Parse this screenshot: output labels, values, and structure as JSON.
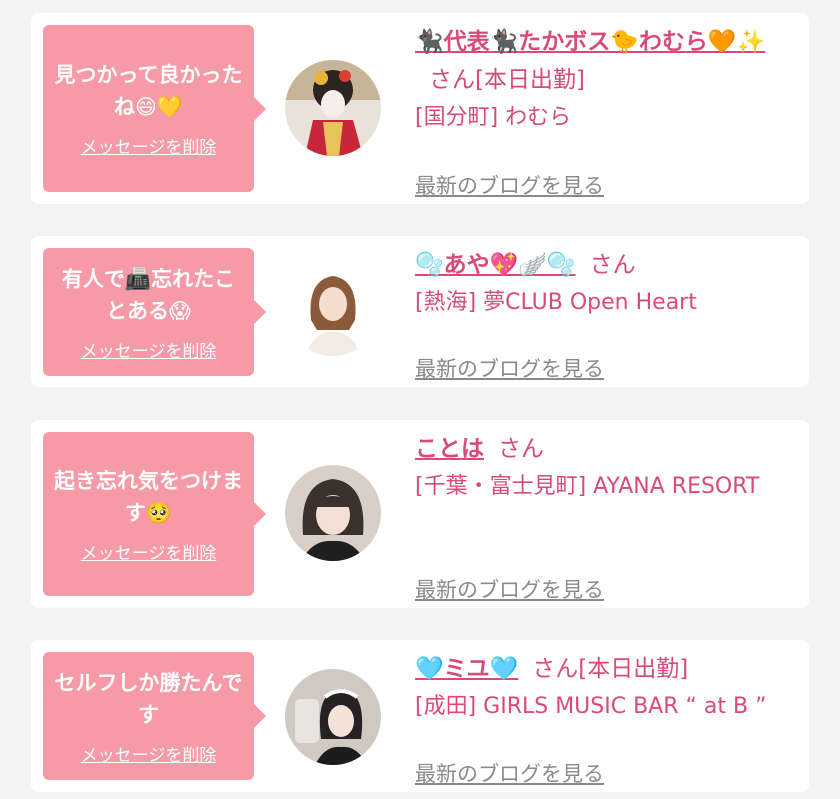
{
  "colors": {
    "bubble": "#f59aa6",
    "accent": "#d94a7a",
    "link_gray": "#8a8a8a"
  },
  "cards": [
    {
      "message": "見つかって良かったね😄💛",
      "delete": "メッセージを削除",
      "name": "🐈‍⬛代表🐈‍⬛たかボス🐤わむら🧡✨",
      "san": "さん",
      "status": "[本日出勤]",
      "shop": "[国分町] わむら",
      "blog": "最新のブログを見る"
    },
    {
      "message": "有人で📠忘れたことある😱",
      "delete": "メッセージを削除",
      "name": "🫧あや💖🪽🫧",
      "san": "さん",
      "status": "",
      "shop": "[熱海] 夢CLUB Open Heart",
      "blog": "最新のブログを見る"
    },
    {
      "message": "起き忘れ気をつけます🥺",
      "delete": "メッセージを削除",
      "name": "ことは",
      "san": "さん",
      "status": "",
      "shop": "[千葉・富士見町] AYANA RESORT",
      "blog": "最新のブログを見る"
    },
    {
      "message": "セルフしか勝たんです",
      "delete": "メッセージを削除",
      "name": "🩵ミユ🩵",
      "san": "さん",
      "status": "[本日出勤]",
      "shop": "[成田] GIRLS MUSIC BAR “ at B ”",
      "blog": "最新のブログを見る"
    }
  ]
}
